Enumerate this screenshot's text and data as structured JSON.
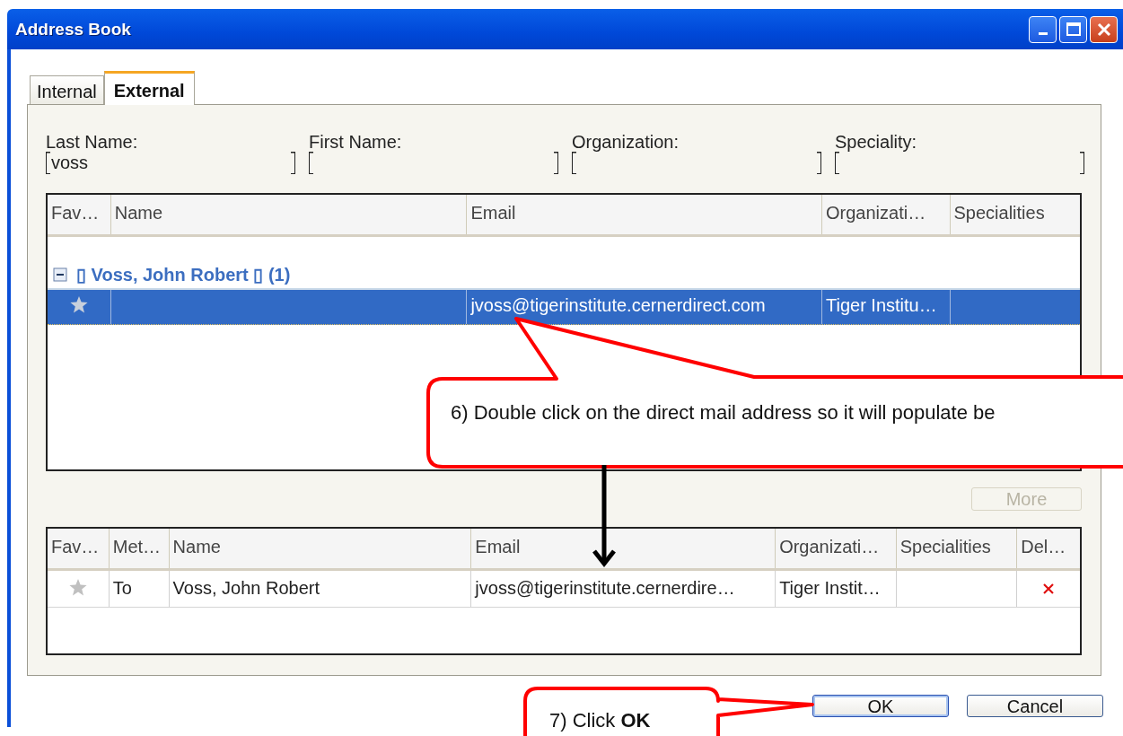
{
  "window": {
    "title": "Address Book"
  },
  "tabs": [
    {
      "label": "Internal",
      "selected": false
    },
    {
      "label": "External",
      "selected": true
    }
  ],
  "filters": [
    {
      "label": "Last Name:",
      "value": "voss"
    },
    {
      "label": "First Name:"
    },
    {
      "label": "Organization:"
    },
    {
      "label": "Speciality:"
    }
  ],
  "results": {
    "columns": [
      "Fav…",
      "Name",
      "Email",
      "Organizati…",
      "Specialities"
    ],
    "groups": [
      {
        "label": "▯ Voss, John Robert ▯ (1)",
        "expanded": true,
        "rows": [
          {
            "selected": true,
            "email": "jvoss@tigerinstitute.cernerdirect.com",
            "organization": "Tiger Institu…"
          }
        ]
      }
    ]
  },
  "more_button": {
    "label": "More",
    "disabled": true
  },
  "recipients": {
    "columns": [
      "Fav…",
      "Met…",
      "Name",
      "Email",
      "Organizati…",
      "Specialities",
      "Del…"
    ],
    "rows": [
      {
        "method": "To",
        "name": "Voss, John Robert",
        "email": "jvoss@tigerinstitute.cernerdire…",
        "organization": "Tiger Instit…"
      }
    ]
  },
  "buttons": [
    {
      "label": "OK",
      "default": true
    },
    {
      "label": "Cancel",
      "default": false
    }
  ],
  "annotations": [
    {
      "text": "6) Double click on the direct mail address so it will populate be"
    },
    {
      "text": "7) Click **OK**"
    }
  ]
}
